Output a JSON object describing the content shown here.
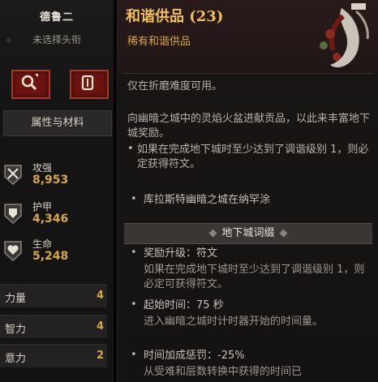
{
  "character": {
    "name": "德鲁二",
    "title_placeholder": "未选择头衔",
    "attributes_tab": "属性与材料",
    "stats": [
      {
        "label": "攻强",
        "value": "8,953",
        "icon": "swords-icon"
      },
      {
        "label": "护甲",
        "value": "4,346",
        "icon": "armor-icon"
      },
      {
        "label": "生命",
        "value": "5,248",
        "icon": "heart-icon"
      }
    ],
    "attributes": [
      {
        "name": "力量",
        "value": "4"
      },
      {
        "name": "智力",
        "value": "4"
      },
      {
        "name": "意力",
        "value": "2"
      }
    ]
  },
  "tooltip": {
    "title": "和谐供品 (23)",
    "rarity": "稀有和谐供品",
    "note": "仅在折磨难度可用。",
    "desc": "向幽暗之城中的灵焰火盆进献贡品，以此来丰富地下城奖励。",
    "desc_bullet": "如果在完成地下城时至少达到了调谐级别 1，则必定获得符文。",
    "location": "库拉斯特幽暗之城在纳罕涂",
    "section": "地下城词缀",
    "affixes": [
      {
        "title": "奖励升级：符文",
        "body": "如果在完成地下城时至少达到了调谐级别 1，则必定可获得符文。"
      },
      {
        "title": "起始时间：75 秒",
        "body": "进入幽暗之城时计时器开始的时间量。"
      },
      {
        "title": "时间加成惩罚：-25%",
        "body": "从受难和层数转换中获得的时间已"
      }
    ]
  },
  "colors": {
    "accent": "#f0c05a",
    "rarity": "#d6a64a",
    "text": "#b9b2a8",
    "button": "#6b1410"
  }
}
